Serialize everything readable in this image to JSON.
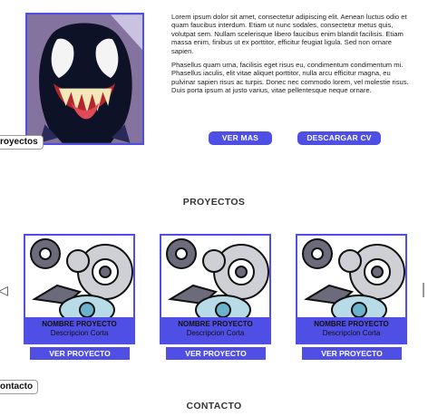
{
  "about": {
    "paragraph_1": "Lorem ipsum dolor sit amet, consectetur adipiscing elit. Aenean luctus odio et quam faucibus interdum. Etiam ut nunc sodales, consectetur metus quis, volutpat sem. Nullam scelerisque libero faucibus enim blandit facilisis. Etiam massa enim, finibus ut ex porttitor, efficitur feugiat ligula. Sed non ornare sapien.",
    "paragraph_2": "Phasellus quam urna, facilisis eget risus eu, condimentum condimentum mi. Phasellus iaculis, elit vitae aliquet porttitor, nulla arcu efficitur magna, eu pulvinar sapien risus ac turpis. Donec nec commodo lorem, vel molestie risus. Duis porta ipsum at justo varius, vitae pellentesque neque ornare.",
    "ver_mas_label": "VER MAS",
    "cv_label": "DESCARGAR CV"
  },
  "nav": {
    "proyectos_label": "royectos",
    "contacto_label": "ontacto"
  },
  "sections": {
    "proyectos_title": "PROYECTOS",
    "contacto_title": "CONTACTO"
  },
  "carousel": {
    "prev_glyph": "◁",
    "cards": [
      {
        "name": "NOMBRE PROYECTO",
        "description": "Descripcion Corta",
        "button_label": "VER PROYECTO"
      },
      {
        "name": "NOMBRE PROYECTO",
        "description": "Descripcion Corta",
        "button_label": "VER PROYECTO"
      },
      {
        "name": "NOMBRE PROYECTO",
        "description": "Descripcion Corta",
        "button_label": "VER PROYECTO"
      }
    ]
  },
  "colors": {
    "accent": "#4f4fe6",
    "text": "#111111",
    "background": "#ffffff"
  },
  "icons": {
    "hero_image": "venom-portrait-image",
    "project_image": "gears-eye-icon"
  }
}
